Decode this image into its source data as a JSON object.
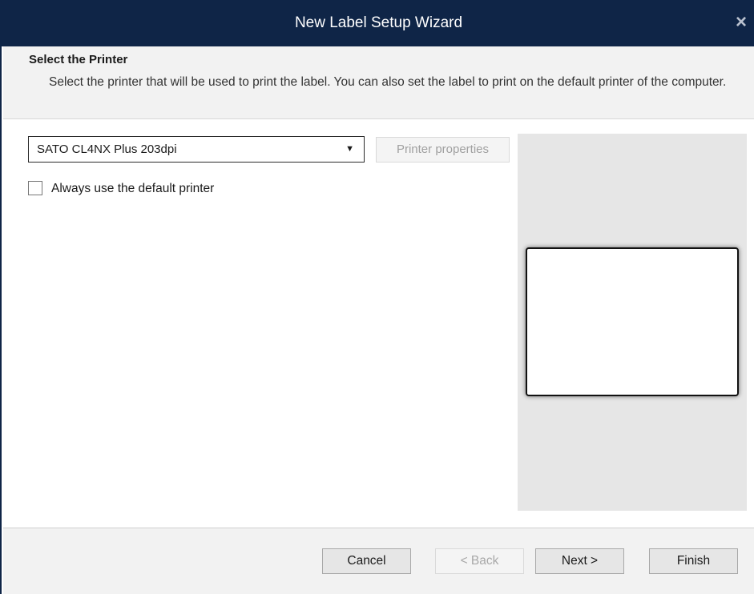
{
  "window": {
    "title": "New Label Setup Wizard",
    "close_icon": "×"
  },
  "header": {
    "title": "Select the Printer",
    "description": "Select the printer that will be used to print the label. You can also set the label to print on the default printer of the computer."
  },
  "printer": {
    "selected": "SATO CL4NX Plus 203dpi",
    "dropdown_icon": "▼",
    "properties_label": "Printer properties",
    "properties_enabled": false
  },
  "default_printer": {
    "label": "Always use the default printer",
    "checked": false
  },
  "footer": {
    "cancel_label": "Cancel",
    "back_label": "< Back",
    "back_enabled": false,
    "next_label": "Next >",
    "finish_label": "Finish"
  },
  "colors": {
    "titlebar": "#0f2547",
    "panel_background": "#f2f2f2",
    "preview_background": "#e6e6e6"
  }
}
